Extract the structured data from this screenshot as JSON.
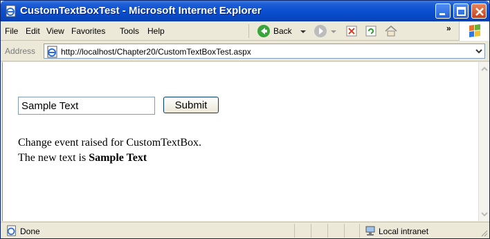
{
  "window": {
    "title": "CustomTextBoxTest - Microsoft Internet Explorer"
  },
  "menubar": {
    "items": [
      "File",
      "Edit",
      "View",
      "Favorites",
      "Tools",
      "Help"
    ],
    "back_label": "Back",
    "chevron": "»"
  },
  "addressbar": {
    "label": "Address",
    "url": "http://localhost/Chapter20/CustomTextBoxTest.aspx"
  },
  "page": {
    "textbox_value": "Sample Text",
    "submit_label": "Submit",
    "line1": "Change event raised for CustomTextBox.",
    "line2_prefix": "The new text is ",
    "line2_bold": "Sample Text"
  },
  "statusbar": {
    "status": "Done",
    "zone": "Local intranet"
  },
  "colors": {
    "titlebar": "#0a4fd0",
    "chrome": "#ece9d8",
    "close_button": "#c4431c"
  }
}
